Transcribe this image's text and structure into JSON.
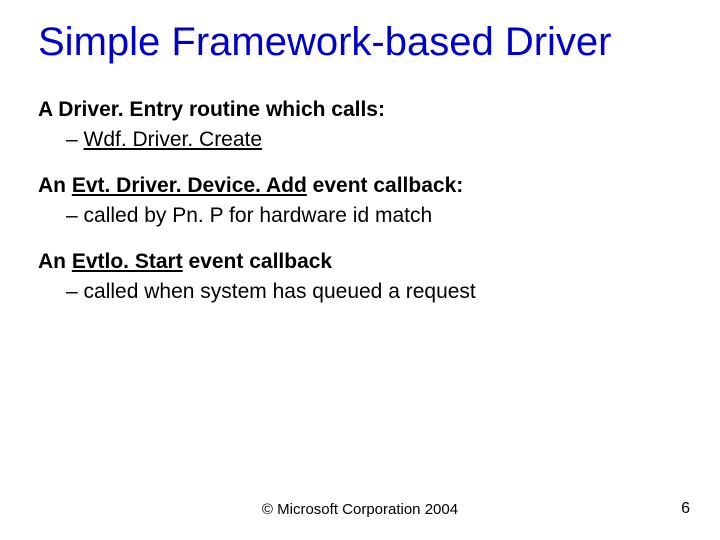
{
  "title": "Simple Framework-based Driver",
  "blocks": [
    {
      "lead_before": "A Driver. Entry routine which calls:",
      "lead_underline": "",
      "lead_after": "",
      "sub_before": "",
      "sub_underline": "Wdf. Driver. Create",
      "sub_after": ""
    },
    {
      "lead_before": "An ",
      "lead_underline": "Evt. Driver. Device. Add",
      "lead_after": " event callback:",
      "sub_before": "called by Pn. P for hardware id match",
      "sub_underline": "",
      "sub_after": ""
    },
    {
      "lead_before": "An ",
      "lead_underline": "Evtlo. Start",
      "lead_after": " event callback",
      "sub_before": "called when system has queued a request",
      "sub_underline": "",
      "sub_after": ""
    }
  ],
  "footer": {
    "copyright": "© Microsoft Corporation 2004",
    "page": "6"
  }
}
